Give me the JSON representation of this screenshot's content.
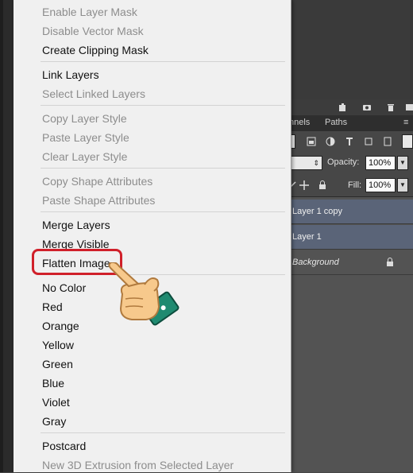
{
  "context_menu": {
    "items": [
      {
        "label": "Enable Layer Mask",
        "enabled": false
      },
      {
        "label": "Disable Vector Mask",
        "enabled": false
      },
      {
        "label": "Create Clipping Mask",
        "enabled": true
      },
      {
        "label": "Link Layers",
        "enabled": true
      },
      {
        "label": "Select Linked Layers",
        "enabled": false
      },
      {
        "label": "Copy Layer Style",
        "enabled": false
      },
      {
        "label": "Paste Layer Style",
        "enabled": false
      },
      {
        "label": "Clear Layer Style",
        "enabled": false
      },
      {
        "label": "Copy Shape Attributes",
        "enabled": false
      },
      {
        "label": "Paste Shape Attributes",
        "enabled": false
      },
      {
        "label": "Merge Layers",
        "enabled": true
      },
      {
        "label": "Merge Visible",
        "enabled": true
      },
      {
        "label": "Flatten Image",
        "enabled": true,
        "highlighted": true
      },
      {
        "label": "No Color",
        "enabled": true
      },
      {
        "label": "Red",
        "enabled": true
      },
      {
        "label": "Orange",
        "enabled": true
      },
      {
        "label": "Yellow",
        "enabled": true
      },
      {
        "label": "Green",
        "enabled": true
      },
      {
        "label": "Blue",
        "enabled": true
      },
      {
        "label": "Violet",
        "enabled": true
      },
      {
        "label": "Gray",
        "enabled": true
      },
      {
        "label": "Postcard",
        "enabled": true
      },
      {
        "label": "New 3D Extrusion from Selected Layer",
        "enabled": false
      }
    ]
  },
  "layers_panel": {
    "tabs": [
      "nnels",
      "Paths"
    ],
    "opacity_label": "Opacity:",
    "opacity_value": "100%",
    "fill_label": "Fill:",
    "fill_value": "100%",
    "layers": [
      {
        "name": "Layer 1 copy",
        "selected": true
      },
      {
        "name": "Layer 1",
        "selected": true
      },
      {
        "name": "Background",
        "selected": false,
        "locked": true
      }
    ]
  },
  "colors": {
    "highlight_ring": "#d0202a",
    "hand_skin": "#f7c98c",
    "hand_cuff": "#1f8a70"
  }
}
